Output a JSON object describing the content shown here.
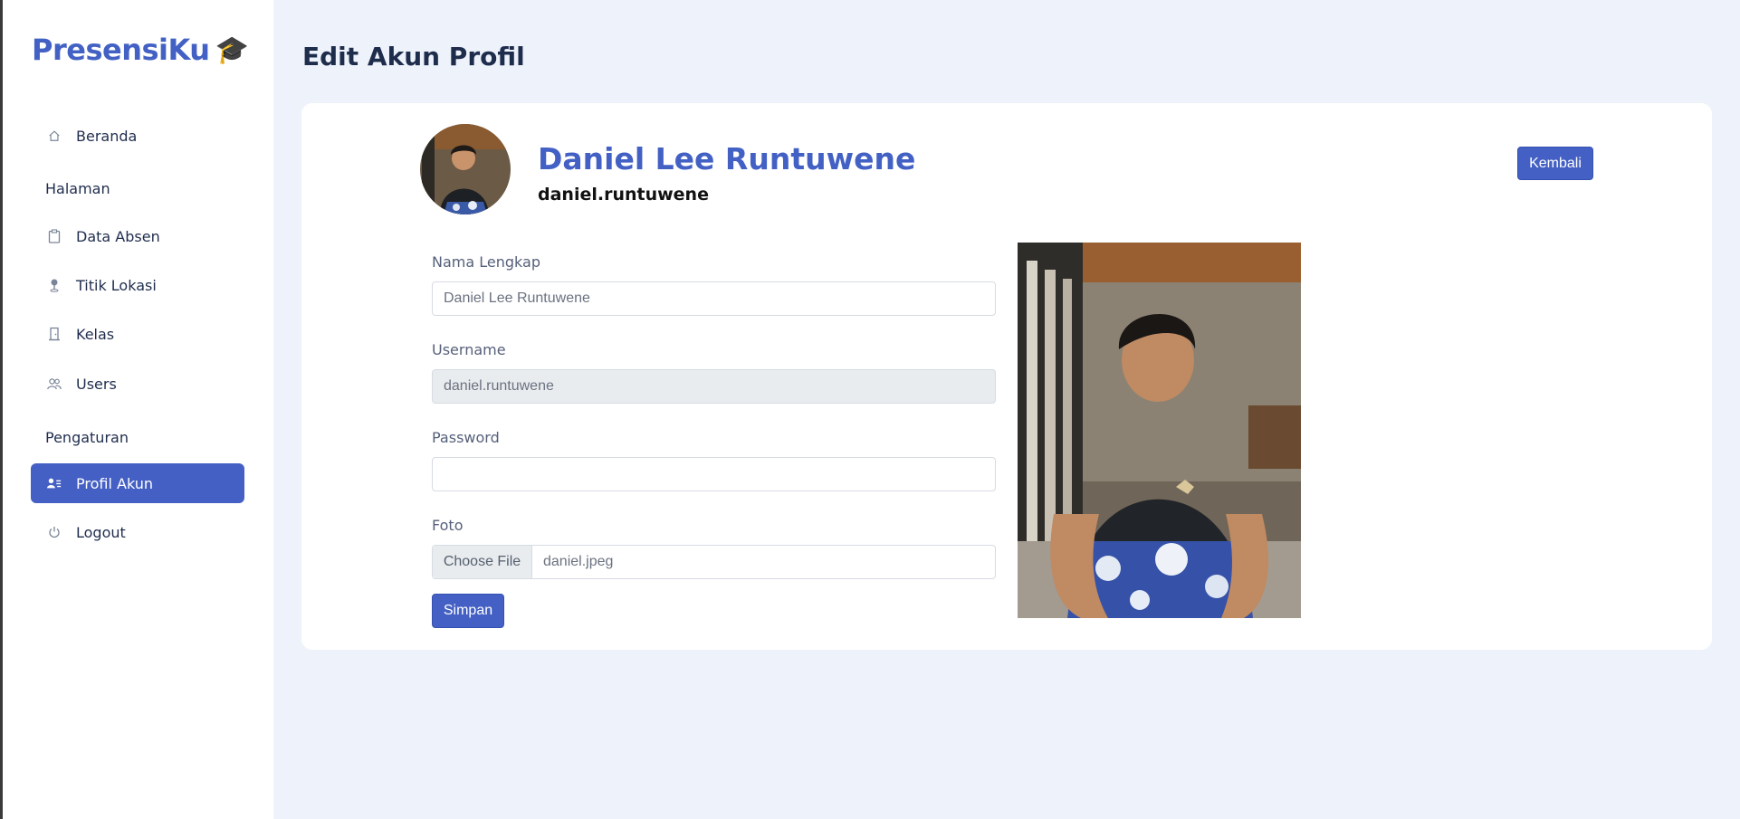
{
  "app": {
    "brand": "PresensiKu",
    "brand_icon": "graduation-cap-icon",
    "accent": "#4460c4"
  },
  "sidebar": {
    "items": [
      {
        "label": "Beranda",
        "icon": "home-icon"
      },
      {
        "label": "Data Absen",
        "icon": "clipboard-icon"
      },
      {
        "label": "Titik Lokasi",
        "icon": "map-pin-icon"
      },
      {
        "label": "Kelas",
        "icon": "building-icon"
      },
      {
        "label": "Users",
        "icon": "users-icon"
      },
      {
        "label": "Profil Akun",
        "icon": "user-card-icon",
        "active": true
      },
      {
        "label": "Logout",
        "icon": "power-icon"
      }
    ],
    "sections": {
      "halaman": "Halaman",
      "pengaturan": "Pengaturan"
    }
  },
  "page": {
    "title": "Edit Akun Profil"
  },
  "profile": {
    "name": "Daniel Lee Runtuwene",
    "username": "daniel.runtuwene",
    "back_label": "Kembali"
  },
  "form": {
    "name_label": "Nama Lengkap",
    "name_value": "Daniel Lee Runtuwene",
    "username_label": "Username",
    "username_value": "daniel.runtuwene",
    "password_label": "Password",
    "password_value": "",
    "photo_label": "Foto",
    "choose_file_label": "Choose File",
    "file_name": "daniel.jpeg",
    "submit_label": "Simpan"
  }
}
